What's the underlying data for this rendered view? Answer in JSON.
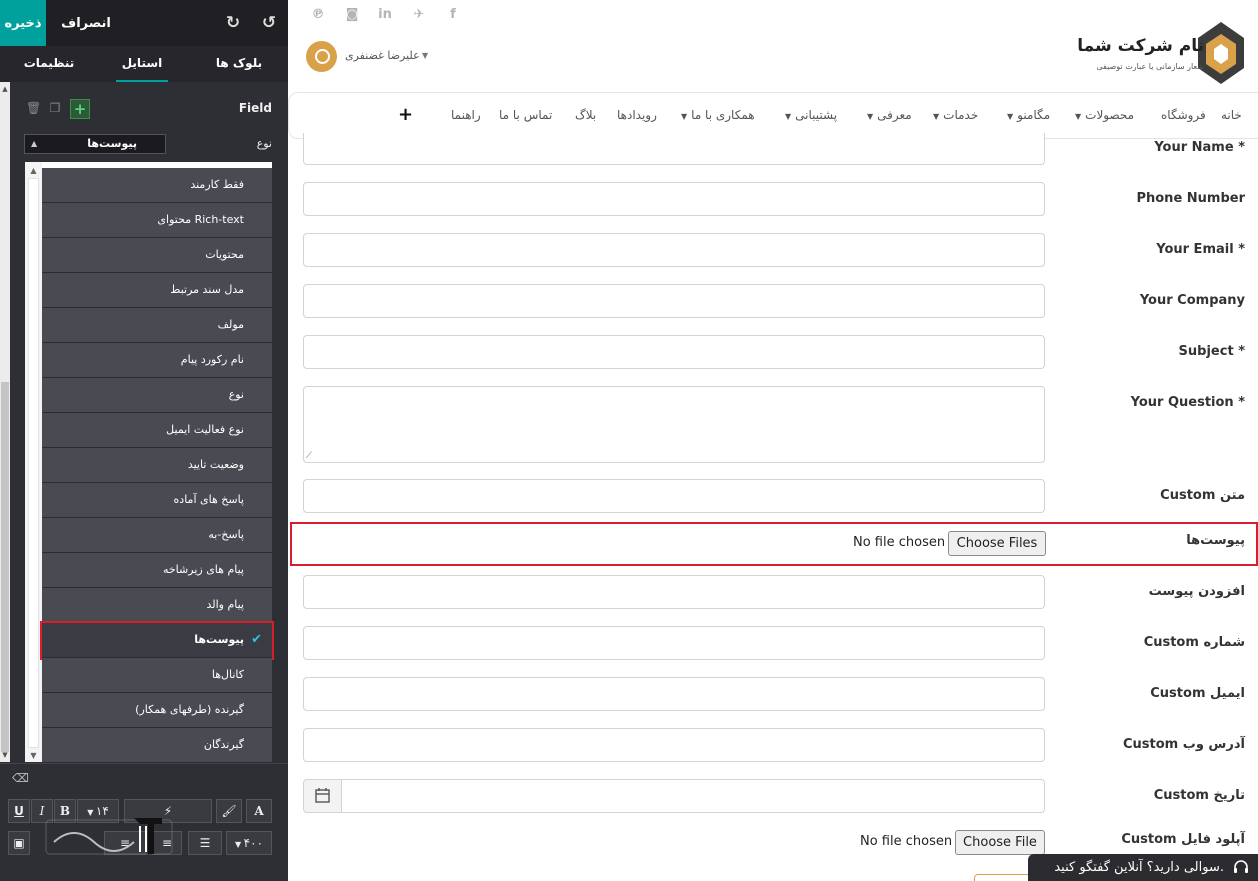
{
  "editor": {
    "save_label": "ذخیره",
    "discard_label": "انصراف",
    "tabs": [
      {
        "label": "تنظیمات"
      },
      {
        "label": "استایل"
      },
      {
        "label": "بلوک ها"
      }
    ],
    "active_tab": "استایل",
    "field_title": "Field",
    "type_label": "نوع",
    "type_value": "پیوست‌ها",
    "dropdown_items": [
      "فقط کارمند",
      "محتوای Rich-text",
      "محتویات",
      "مدل سند مرتبط",
      "مولف",
      "نام رکورد پیام",
      "نوع",
      "نوع فعالیت ایمیل",
      "وضعیت تایید",
      "پاسخ های آماده",
      "پاسخ-به",
      "پیام های زیرشاخه",
      "پیام والد",
      "پیوست‌ها",
      "کانال‌ها",
      "گیرنده (طرفهای همکار)",
      "گیرندگان"
    ],
    "selected_item": "پیوست‌ها",
    "font_size": "۱۴",
    "weight": "۴۰۰"
  },
  "site": {
    "company_name": "نام شرکت شما",
    "company_tagline": "شعار سازمانی یا عبارت توصیفی",
    "user_name": "علیرضا غضنفری",
    "nav": [
      {
        "label": "خانه",
        "dropdown": false
      },
      {
        "label": "فروشگاه",
        "dropdown": false
      },
      {
        "label": "محصولات",
        "dropdown": true
      },
      {
        "label": "مگامنو",
        "dropdown": true
      },
      {
        "label": "خدمات",
        "dropdown": true
      },
      {
        "label": "معرفی",
        "dropdown": true
      },
      {
        "label": "پشتیبانی",
        "dropdown": true
      },
      {
        "label": "همکاری با ما",
        "dropdown": true
      },
      {
        "label": "رویدادها",
        "dropdown": false
      },
      {
        "label": "بلاگ",
        "dropdown": false
      },
      {
        "label": "تماس با ما",
        "dropdown": false
      },
      {
        "label": "راهنما",
        "dropdown": false
      }
    ],
    "fields": {
      "your_name": "Your Name *",
      "phone": "Phone Number",
      "email": "Your Email *",
      "company": "Your Company",
      "subject": "Subject *",
      "question": "Your Question *",
      "custom_text": "Custom متن",
      "attachments": "پیوست‌ها",
      "add_attachment": "افزودن پیوست",
      "custom_number": "Custom شماره",
      "custom_email": "Custom ایمیل",
      "custom_web": "Custom آدرس وب",
      "custom_date": "Custom تاریخ",
      "custom_upload": "Custom آپلود فایل"
    },
    "file_attach": {
      "status": "No file chosen",
      "button": "Choose Files"
    },
    "file_upload": {
      "status": "No file chosen",
      "button": "Choose File"
    },
    "chat_text": "سوالی دارید؟ آنلاین گفتگو کنید."
  },
  "colors": {
    "accent": "#00a09d",
    "highlight_red": "#d61f2c",
    "check_blue": "#2ec2e8",
    "avatar_gold": "#d9a24a",
    "logo_dark": "#3c3c3c",
    "logo_gold": "#d9a24a"
  }
}
